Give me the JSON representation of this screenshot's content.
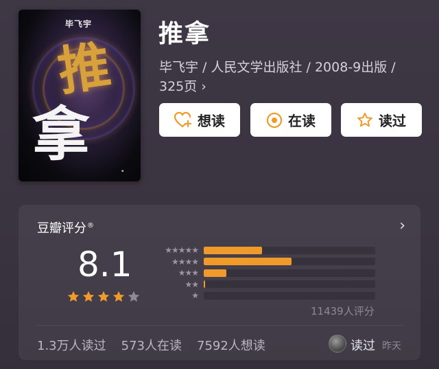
{
  "book": {
    "title": "推拿",
    "meta_line1": "毕飞宇 / 人民文学出版社 / 2008-9出版 /",
    "meta_line2": "325页",
    "cover": {
      "author": "毕飞宇",
      "char_1": "推",
      "char_2": "拿"
    }
  },
  "actions": {
    "want": "想读",
    "reading": "在读",
    "read": "读过"
  },
  "rating": {
    "title": "豆瓣评分",
    "mark": "®",
    "score": "8.1",
    "stars_filled": 4,
    "stars_total": 5,
    "distribution": [
      {
        "stars": 5,
        "percent": 34
      },
      {
        "stars": 4,
        "percent": 51
      },
      {
        "stars": 3,
        "percent": 13
      },
      {
        "stars": 2,
        "percent": 1
      },
      {
        "stars": 1,
        "percent": 0
      }
    ],
    "count": "11439人评分"
  },
  "stats": {
    "read": "1.3万人读过",
    "reading": "573人在读",
    "want": "7592人想读"
  },
  "my": {
    "status": "读过",
    "time": "昨天"
  },
  "colors": {
    "accent": "#f09a29",
    "background": "#3b3441",
    "button_bg": "#ffffff"
  }
}
